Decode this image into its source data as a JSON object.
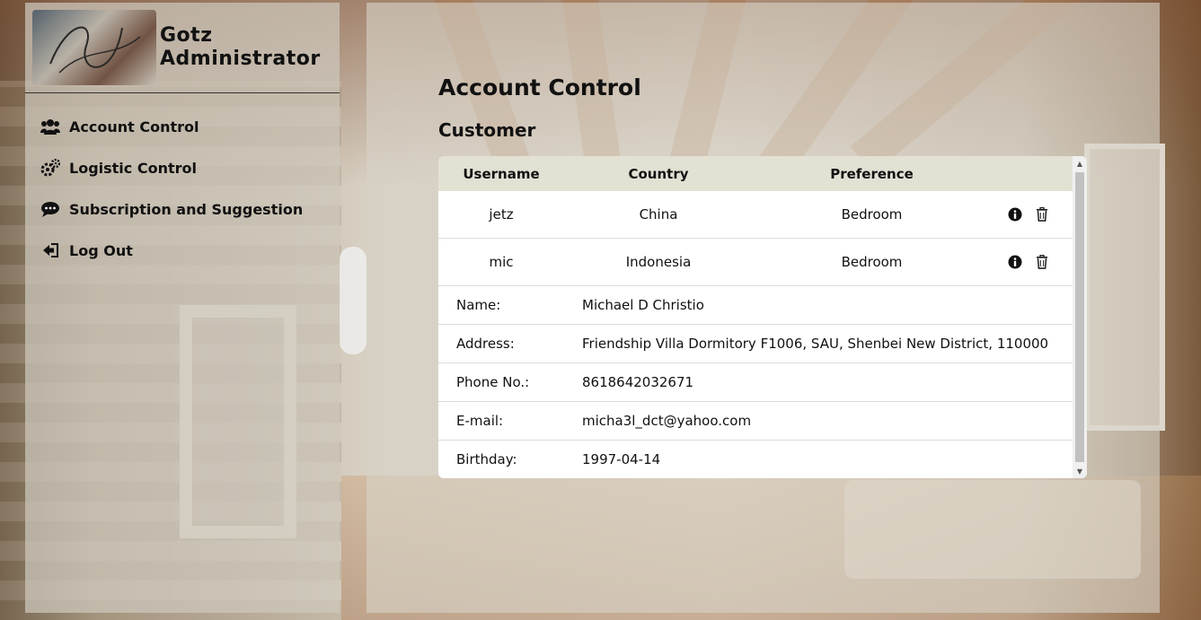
{
  "sidebar": {
    "brand_line1": "Gotz",
    "brand_line2": "Administrator",
    "items": [
      {
        "label": "Account Control",
        "icon": "users-icon"
      },
      {
        "label": "Logistic Control",
        "icon": "gears-icon"
      },
      {
        "label": "Subscription and Suggestion",
        "icon": "comment-icon"
      },
      {
        "label": "Log Out",
        "icon": "sign-out-icon"
      }
    ]
  },
  "main": {
    "title": "Account Control",
    "section": "Customer",
    "table": {
      "headers": [
        "Username",
        "Country",
        "Preference"
      ],
      "rows": [
        {
          "username": "jetz",
          "country": "China",
          "preference": "Bedroom"
        },
        {
          "username": "mic",
          "country": "Indonesia",
          "preference": "Bedroom"
        }
      ],
      "details": [
        {
          "label": "Name:",
          "value": "Michael D Christio"
        },
        {
          "label": "Address:",
          "value": "Friendship Villa Dormitory F1006, SAU, Shenbei New District, 110000"
        },
        {
          "label": "Phone No.:",
          "value": "8618642032671"
        },
        {
          "label": "E-mail:",
          "value": "micha3l_dct@yahoo.com"
        },
        {
          "label": "Birthday:",
          "value": "1997-04-14"
        }
      ]
    }
  },
  "colors": {
    "table_header_bg": "#e3e1d4",
    "panel_bg": "#d7d2c6",
    "text": "#111111"
  }
}
